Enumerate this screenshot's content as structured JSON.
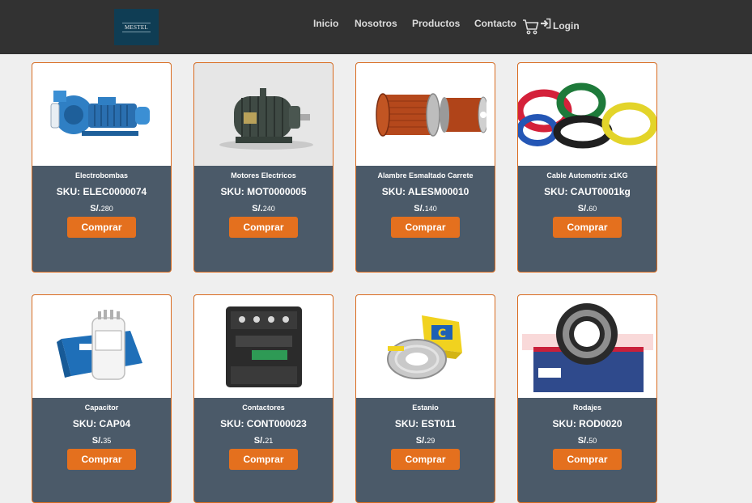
{
  "brand": {
    "logo_text": "MESTEL"
  },
  "nav": {
    "items": [
      "Inicio",
      "Nosotros",
      "Productos",
      "Contacto"
    ],
    "cart_icon": "cart-icon",
    "login_icon": "login-arrow-icon",
    "login_label": "Login"
  },
  "colors": {
    "nav_bg": "#323232",
    "card_bg": "#4b5a69",
    "accent": "#e4701e",
    "border": "#d96b1f"
  },
  "products": [
    {
      "name": "Electrobombas",
      "sku": "SKU: ELEC0000074",
      "currency": "S/.",
      "price": "280",
      "button": "Comprar",
      "image": "water-pump-image"
    },
    {
      "name": "Motores Electricos",
      "sku": "SKU: MOT0000005",
      "currency": "S/.",
      "price": "240",
      "button": "Comprar",
      "image": "electric-motor-image"
    },
    {
      "name": "Alambre Esmaltado Carrete",
      "sku": "SKU: ALESM00010",
      "currency": "S/.",
      "price": "140",
      "button": "Comprar",
      "image": "copper-wire-spool-image"
    },
    {
      "name": "Cable Automotriz x1KG",
      "sku": "SKU: CAUT0001kg",
      "currency": "S/.",
      "price": "60",
      "button": "Comprar",
      "image": "colored-cables-image"
    },
    {
      "name": "Capacitor",
      "sku": "SKU: CAP04",
      "currency": "S/.",
      "price": "35",
      "button": "Comprar",
      "image": "capacitor-image"
    },
    {
      "name": "Contactores",
      "sku": "SKU: CONT000023",
      "currency": "S/.",
      "price": "21",
      "button": "Comprar",
      "image": "contactor-image"
    },
    {
      "name": "Estanio",
      "sku": "SKU: EST011",
      "currency": "S/.",
      "price": "29",
      "button": "Comprar",
      "image": "solder-wire-image"
    },
    {
      "name": "Rodajes",
      "sku": "SKU: ROD0020",
      "currency": "S/.",
      "price": "50",
      "button": "Comprar",
      "image": "ball-bearing-image"
    }
  ]
}
